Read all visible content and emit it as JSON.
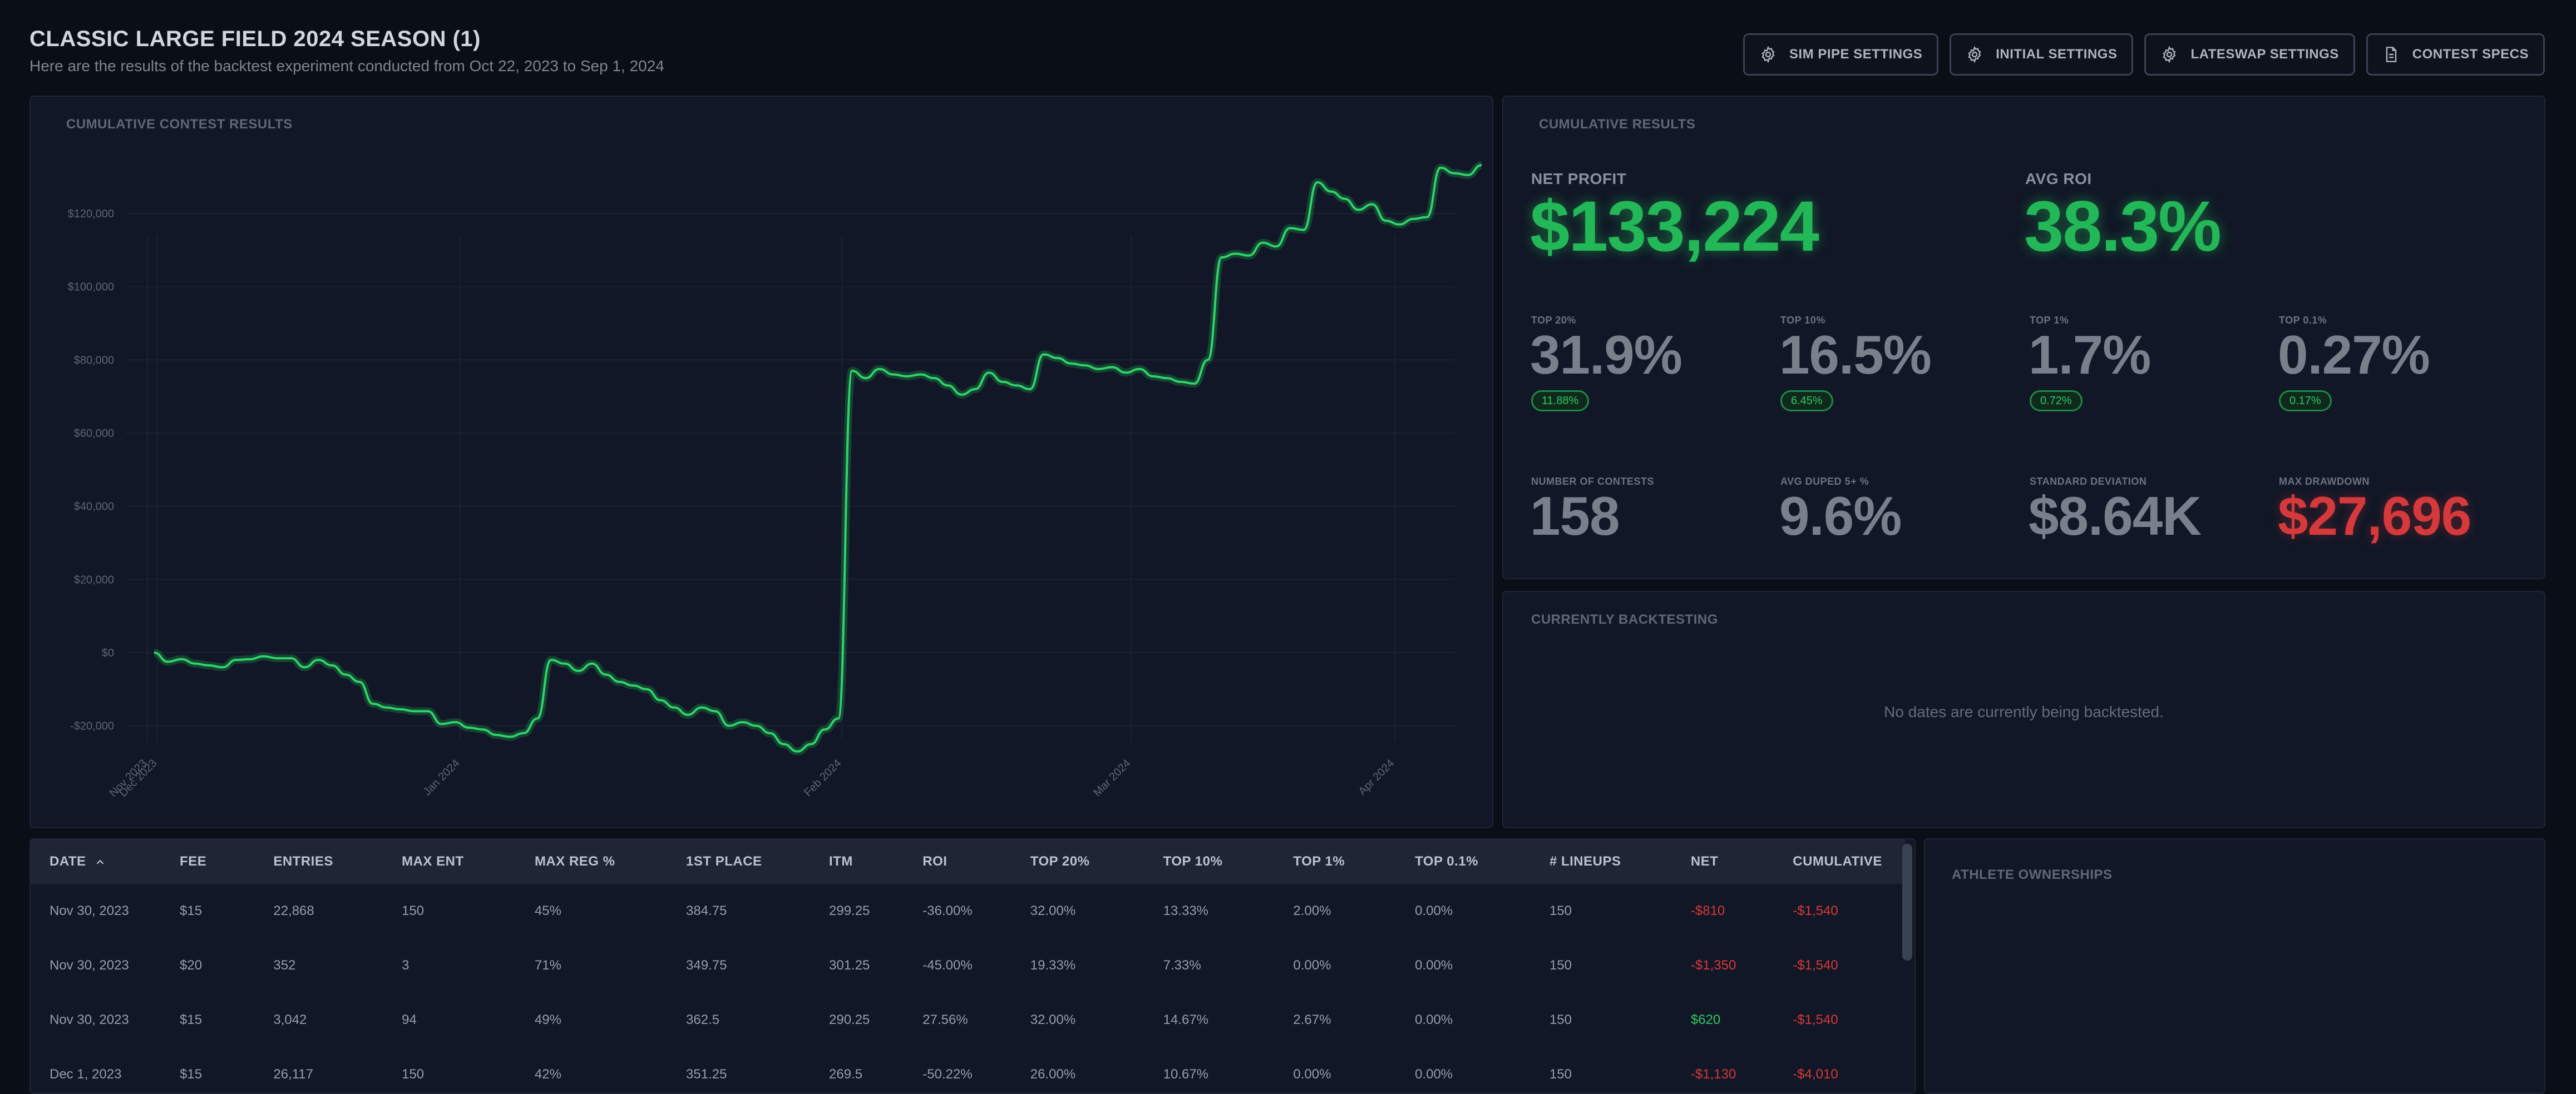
{
  "header": {
    "title": "CLASSIC LARGE FIELD 2024 SEASON (1)",
    "subtitle": "Here are the results of the backtest experiment conducted from Oct 22, 2023 to Sep 1, 2024"
  },
  "toolbar": {
    "buttons": [
      {
        "label": "SIM PIPE SETTINGS",
        "icon": "gear-icon"
      },
      {
        "label": "INITIAL SETTINGS",
        "icon": "gear-icon"
      },
      {
        "label": "LATESWAP SETTINGS",
        "icon": "gear-icon"
      },
      {
        "label": "CONTEST SPECS",
        "icon": "document-icon"
      }
    ]
  },
  "colors": {
    "accent_green": "#22b857",
    "negative_red": "#d6393b",
    "background": "#0a0e17",
    "panel": "#111726"
  },
  "chart_panel": {
    "title": "CUMULATIVE CONTEST RESULTS"
  },
  "chart_data": {
    "type": "line",
    "title": "CUMULATIVE CONTEST RESULTS",
    "xlabel": "",
    "ylabel": "",
    "ylim": [
      -27000,
      135000
    ],
    "y_ticks": [
      "$120,000",
      "$100,000",
      "$80,000",
      "$60,000",
      "$40,000",
      "$20,000",
      "$0",
      "-$20,000"
    ],
    "x_ticks": [
      "Nov 2023",
      "Dec 2023",
      "Jan 2024",
      "Feb 2024",
      "Mar 2024",
      "Apr 2024"
    ],
    "grid": true,
    "series": [
      {
        "values": [
          0,
          -2500,
          -1800,
          -3000,
          -3500,
          -4000,
          -2000,
          -1800,
          -1000,
          -1540,
          -1540,
          -4010,
          -2000,
          -3500,
          -6000,
          -8000,
          -14000,
          -15000,
          -15500,
          -16000,
          -16000,
          -19500,
          -19000,
          -20500,
          -21000,
          -22500,
          -23000,
          -22000,
          -18000,
          -2000,
          -3000,
          -5000,
          -3000,
          -6000,
          -8000,
          -9000,
          -10000,
          -13000,
          -15000,
          -17000,
          -15000,
          -16000,
          -20000,
          -19000,
          -20000,
          -22000,
          -25000,
          -27000,
          -25000,
          -21000,
          -18000,
          77000,
          75000,
          77500,
          76000,
          75500,
          76000,
          75000,
          73000,
          70500,
          72000,
          76500,
          74000,
          73000,
          72000,
          81500,
          80500,
          79000,
          78500,
          77500,
          78000,
          76500,
          77500,
          75500,
          75000,
          74000,
          73500,
          80000,
          108000,
          109000,
          108500,
          112000,
          111000,
          116000,
          115500,
          128500,
          126000,
          124000,
          121000,
          122500,
          118000,
          117000,
          118500,
          119000,
          132500,
          131000,
          130500,
          133224
        ]
      }
    ]
  },
  "results_panel": {
    "title": "CUMULATIVE RESULTS",
    "net_profit_label": "NET PROFIT",
    "net_profit": "$133,224",
    "avg_roi_label": "AVG ROI",
    "avg_roi": "38.3%",
    "tops": [
      {
        "label": "TOP 20%",
        "value": "31.9%",
        "pill": "11.88%"
      },
      {
        "label": "TOP 10%",
        "value": "16.5%",
        "pill": "6.45%"
      },
      {
        "label": "TOP 1%",
        "value": "1.7%",
        "pill": "0.72%"
      },
      {
        "label": "TOP 0.1%",
        "value": "0.27%",
        "pill": "0.17%"
      }
    ],
    "stats": [
      {
        "label": "NUMBER OF CONTESTS",
        "value": "158"
      },
      {
        "label": "AVG DUPED 5+ %",
        "value": "9.6%"
      },
      {
        "label": "STANDARD DEVIATION",
        "value": "$8.64K"
      },
      {
        "label": "MAX DRAWDOWN",
        "value": "$27,696"
      }
    ]
  },
  "backtest_panel": {
    "title": "CURRENTLY BACKTESTING",
    "message": "No dates are currently being backtested."
  },
  "table": {
    "headers": [
      "DATE",
      "FEE",
      "ENTRIES",
      "MAX ENT",
      "MAX REG %",
      "1ST PLACE",
      "ITM",
      "ROI",
      "TOP 20%",
      "TOP 10%",
      "TOP 1%",
      "TOP 0.1%",
      "# LINEUPS",
      "NET",
      "CUMULATIVE"
    ],
    "rows": [
      [
        "Nov 30, 2023",
        "$15",
        "22,868",
        "150",
        "45%",
        "384.75",
        "299.25",
        "-36.00%",
        "32.00%",
        "13.33%",
        "2.00%",
        "0.00%",
        "150",
        "-$810",
        "-$1,540"
      ],
      [
        "Nov 30, 2023",
        "$20",
        "352",
        "3",
        "71%",
        "349.75",
        "301.25",
        "-45.00%",
        "19.33%",
        "7.33%",
        "0.00%",
        "0.00%",
        "150",
        "-$1,350",
        "-$1,540"
      ],
      [
        "Nov 30, 2023",
        "$15",
        "3,042",
        "94",
        "49%",
        "362.5",
        "290.25",
        "27.56%",
        "32.00%",
        "14.67%",
        "2.67%",
        "0.00%",
        "150",
        "$620",
        "-$1,540"
      ],
      [
        "Dec 1, 2023",
        "$15",
        "26,117",
        "150",
        "42%",
        "351.25",
        "269.5",
        "-50.22%",
        "26.00%",
        "10.67%",
        "0.00%",
        "0.00%",
        "150",
        "-$1,130",
        "-$4,010"
      ]
    ]
  },
  "athlete_panel": {
    "title": "ATHLETE OWNERSHIPS"
  }
}
